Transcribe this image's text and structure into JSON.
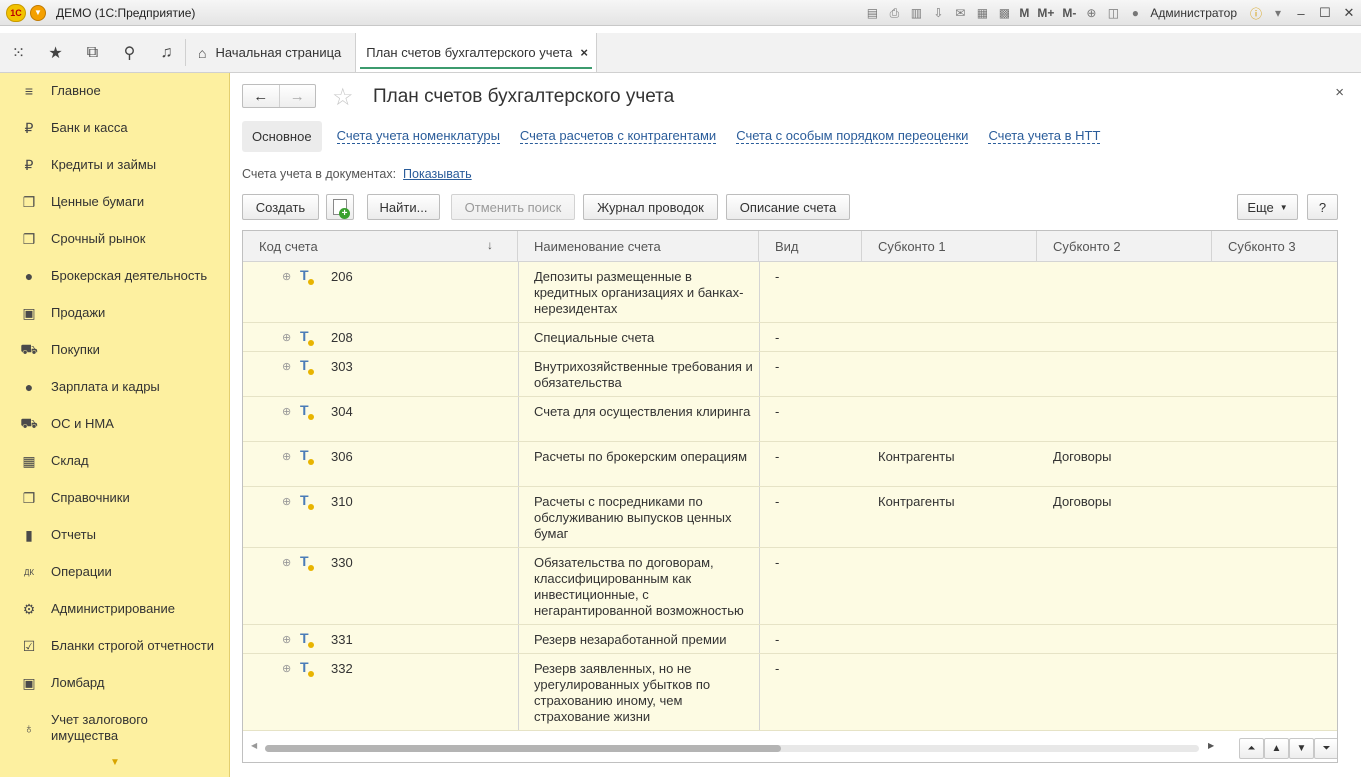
{
  "titlebar": {
    "logo_text": "1С",
    "title": "ДЕМО  (1С:Предприятие)",
    "m_buttons": [
      "M",
      "M+",
      "M-"
    ],
    "user": "Администратор"
  },
  "tabs": {
    "home": "Начальная страница",
    "active": "План счетов бухгалтерского учета",
    "close": "×"
  },
  "sidebar": {
    "items": [
      {
        "label": "Главное",
        "icon": "≡"
      },
      {
        "label": "Банк и касса",
        "icon": "₽"
      },
      {
        "label": "Кредиты и займы",
        "icon": "₽"
      },
      {
        "label": "Ценные бумаги",
        "icon": "❐"
      },
      {
        "label": "Срочный рынок",
        "icon": "❐"
      },
      {
        "label": "Брокерская деятельность",
        "icon": "●"
      },
      {
        "label": "Продажи",
        "icon": "▣"
      },
      {
        "label": "Покупки",
        "icon": "⛟"
      },
      {
        "label": "Зарплата и кадры",
        "icon": "●"
      },
      {
        "label": "ОС и НМА",
        "icon": "⛟"
      },
      {
        "label": "Склад",
        "icon": "▦"
      },
      {
        "label": "Справочники",
        "icon": "❐"
      },
      {
        "label": "Отчеты",
        "icon": "▮"
      },
      {
        "label": "Операции",
        "icon": "ДК"
      },
      {
        "label": "Администрирование",
        "icon": "⚙"
      },
      {
        "label": "Бланки строгой отчетности",
        "icon": "☑"
      },
      {
        "label": "Ломбард",
        "icon": "▣"
      },
      {
        "label": "Учет залогового имущества",
        "icon": "♁"
      }
    ],
    "more": "▼"
  },
  "page": {
    "title": "План счетов бухгалтерского учета",
    "close": "×",
    "subtabs": {
      "active": "Основное",
      "links": [
        "Счета учета номенклатуры",
        "Счета расчетов с контрагентами",
        "Счета с особым порядком переоценки",
        "Счета учета в НТТ"
      ]
    },
    "docs_label": "Счета учета в документах:",
    "docs_link": "Показывать",
    "buttons": {
      "create": "Создать",
      "find": "Найти...",
      "cancel_search": "Отменить поиск",
      "journal": "Журнал проводок",
      "description": "Описание счета",
      "more": "Еще",
      "help": "?"
    }
  },
  "table": {
    "columns": [
      "Код счета",
      "Наименование счета",
      "Вид",
      "Субконто 1",
      "Субконто 2",
      "Субконто 3"
    ],
    "sort_indicator": "↓",
    "rows": [
      {
        "code": "206",
        "name": "Депозиты размещенные в кредитных организациях и банках-нерезидентах",
        "kind": "-",
        "s1": "",
        "s2": ""
      },
      {
        "code": "208",
        "name": "Специальные счета",
        "kind": "-",
        "s1": "",
        "s2": ""
      },
      {
        "code": "303",
        "name": "Внутрихозяйственные требования и обязательства",
        "kind": "-",
        "s1": "",
        "s2": ""
      },
      {
        "code": "304",
        "name": "Счета для осуществления клиринга",
        "kind": "-",
        "s1": "",
        "s2": ""
      },
      {
        "code": "306",
        "name": "Расчеты по брокерским операциям",
        "kind": "-",
        "s1": "Контрагенты",
        "s2": "Договоры"
      },
      {
        "code": "310",
        "name": "Расчеты с посредниками по обслуживанию выпусков ценных бумаг",
        "kind": "-",
        "s1": "Контрагенты",
        "s2": "Договоры"
      },
      {
        "code": "330",
        "name": "Обязательства по договорам, классифицированным как инвестиционные, с негарантированной возможностью",
        "kind": "-",
        "s1": "",
        "s2": ""
      },
      {
        "code": "331",
        "name": "Резерв незаработанной премии",
        "kind": "-",
        "s1": "",
        "s2": ""
      },
      {
        "code": "332",
        "name": "Резерв заявленных, но не урегулированных убытков по страхованию иному, чем страхование жизни",
        "kind": "-",
        "s1": "",
        "s2": ""
      }
    ],
    "row_marker": "T",
    "expand_marker": "⊕"
  }
}
